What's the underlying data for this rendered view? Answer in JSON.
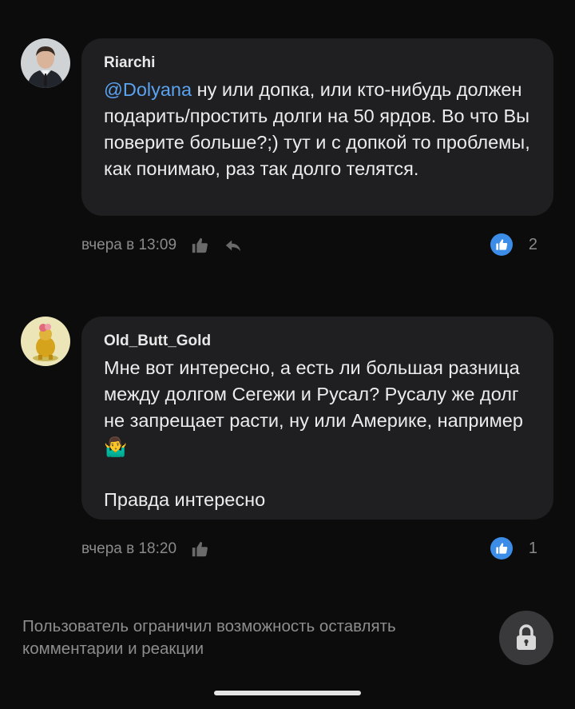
{
  "comments": [
    {
      "author": "Riarchi",
      "mention": "@Dolyana",
      "text": " ну или допка, или кто-нибудь должен подарить/простить долги на 50 ярдов. Во что Вы поверите больше?;) тут и с допкой то проблемы, как понимаю, раз так долго телятся.",
      "time": "вчера в 13:09",
      "likes": "2"
    },
    {
      "author": "Old_Butt_Gold",
      "text": "Мне вот интересно, а есть ли большая разница между долгом Сегежи и Русал? Русалу же долг не запрещает расти, ну или Америке, например 🤷‍♂️",
      "text2": "Правда интересно",
      "time": "вчера в 18:20",
      "likes": "1"
    }
  ],
  "footer": {
    "restriction_text": "Пользователь ограничил возможность оставлять комментарии и реакции"
  },
  "colors": {
    "background": "#0c0c0c",
    "bubble": "#1f1f21",
    "mention": "#5aa3f0",
    "like_badge": "#3b8de8"
  }
}
